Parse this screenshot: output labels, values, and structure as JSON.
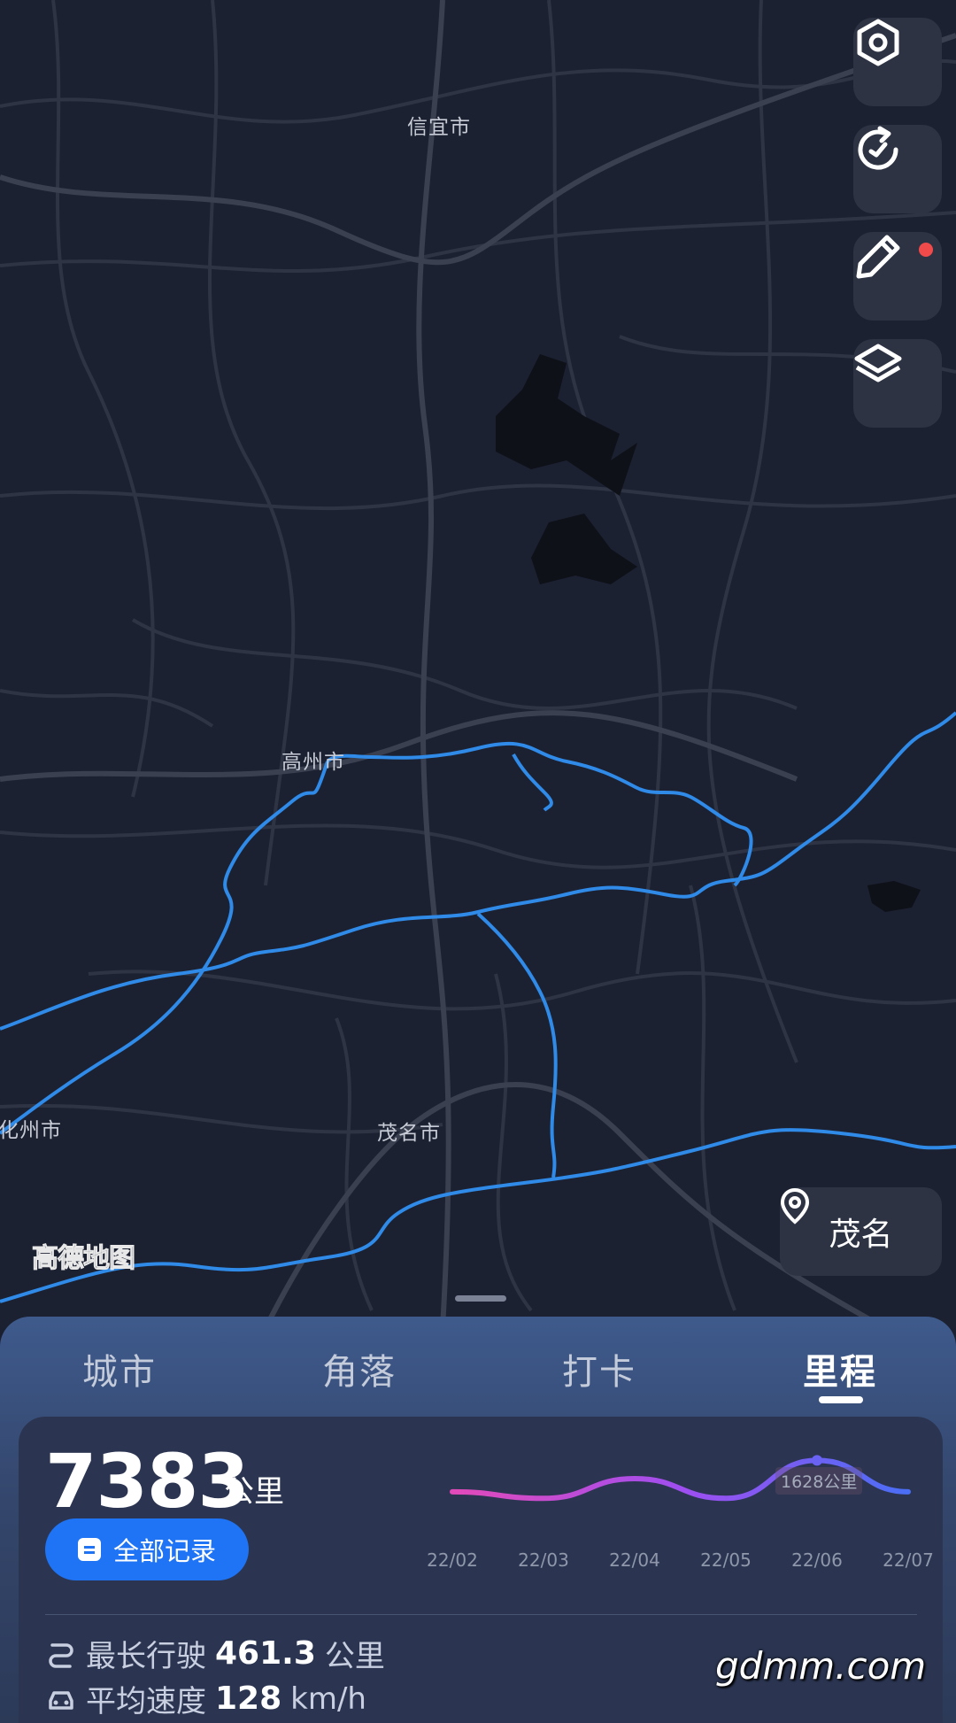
{
  "map": {
    "cities": [
      "信宜市",
      "高州市",
      "化州市",
      "茂名市"
    ],
    "provider_logo": "高德地图",
    "location_button": {
      "label": "茂名",
      "icon": "location-pin-icon"
    },
    "controls": [
      {
        "name": "settings",
        "icon": "hexagon-settings-icon"
      },
      {
        "name": "refresh",
        "icon": "refresh-icon"
      },
      {
        "name": "edit",
        "icon": "pencil-icon",
        "badge": true
      },
      {
        "name": "layers",
        "icon": "layers-icon"
      }
    ],
    "colors": {
      "background": "#1c2131",
      "road": "#343a4a",
      "route": "#2f8ae8",
      "water": "#0d1017"
    }
  },
  "tabs": [
    {
      "label": "城市",
      "active": false
    },
    {
      "label": "角落",
      "active": false
    },
    {
      "label": "打卡",
      "active": false
    },
    {
      "label": "里程",
      "active": true
    }
  ],
  "summary": {
    "total": "7383",
    "unit": "公里",
    "all_records_label": "全部记录"
  },
  "chart_data": {
    "type": "line",
    "categories": [
      "22/02",
      "22/03",
      "22/04",
      "22/05",
      "22/06",
      "22/07"
    ],
    "series": [
      {
        "values": [
          1150,
          1050,
          1350,
          1050,
          1628,
          1150
        ]
      }
    ],
    "annotations": [
      {
        "x": "22/06",
        "label": "1628公里"
      }
    ],
    "title": "",
    "xlabel": "",
    "ylabel": "",
    "colors": {
      "start": "#e24ab9",
      "mid": "#a04ef0",
      "end": "#4a6ef5"
    }
  },
  "stats": {
    "longest_label": "最长行驶",
    "longest_value": "461.3",
    "longest_unit": "公里",
    "speed_label": "平均速度",
    "speed_value": "128",
    "speed_unit": "km/h"
  },
  "watermark": "gdmm.com"
}
